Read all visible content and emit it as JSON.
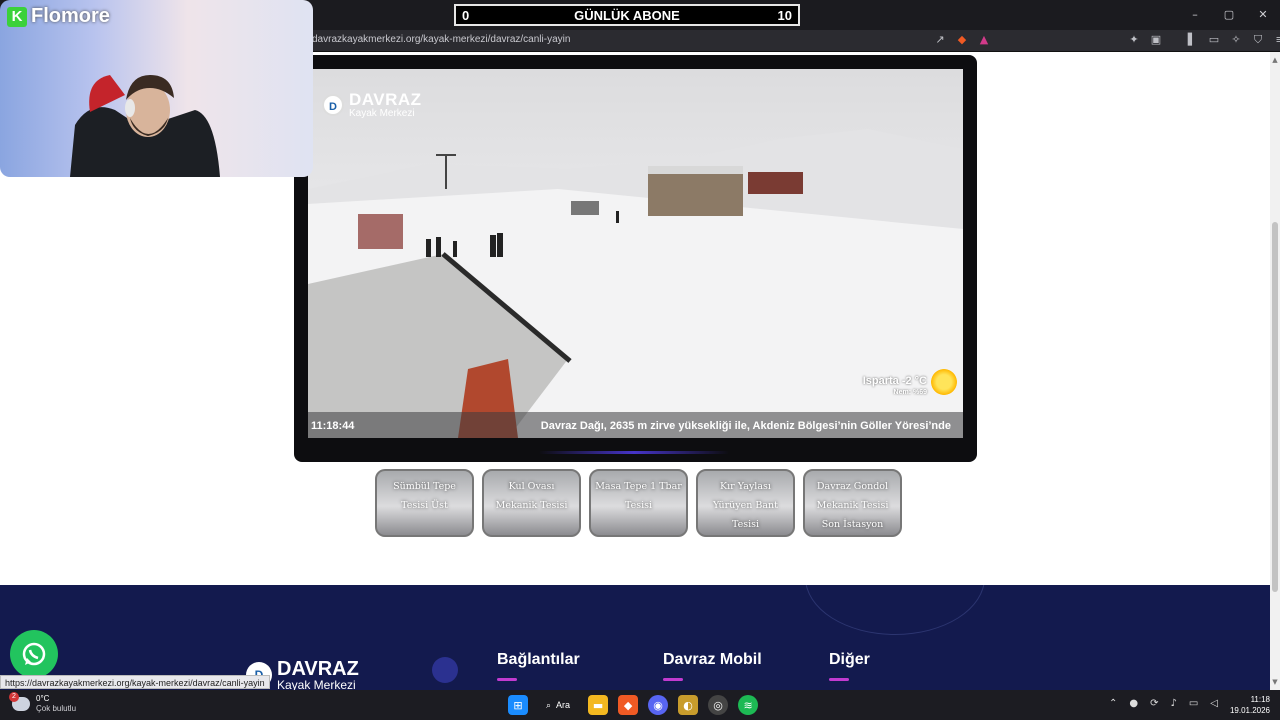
{
  "subscriber_counter": {
    "current": "0",
    "label": "GÜNLÜK ABONE",
    "goal": "10"
  },
  "window_controls": {
    "minimize": "–",
    "maximize": "▢",
    "close": "✕"
  },
  "browser": {
    "url": "davrazkayakmerkezi.org/kayak-merkezi/davraz/canli-yayin"
  },
  "webcam": {
    "brand": "Flomore",
    "brand_initial": "K"
  },
  "stream": {
    "logo_title": "DAVRAZ",
    "logo_subtitle": "Kayak Merkezi",
    "clock": "11:18:44",
    "ticker": "Davraz Dağı, 2635 m zirve yüksekliği ile, Akdeniz Bölgesi’nin Göller Yöresi’nde",
    "weather_location_temp": "Isparta -2 °C",
    "weather_humidity": "Nem: %69",
    "weather_icon": "sun-icon"
  },
  "cameras": [
    {
      "label": "Sümbül Tepe Tesisi Üst"
    },
    {
      "label": "Kul Ovası Mekanik Tesisi"
    },
    {
      "label": "Masa Tepe 1 Tbar Tesisi"
    },
    {
      "label": "Kır Yaylası Yürüyen Bant Tesisi"
    },
    {
      "label": "Davraz Gondol Mekanik Tesisi Son İstasyon"
    }
  ],
  "footer": {
    "logo_title": "DAVRAZ",
    "logo_subtitle": "Kayak Merkezi",
    "headings": [
      "Bağlantılar",
      "Davraz Mobil",
      "Diğer"
    ],
    "accent_color": "#c23bd0"
  },
  "status_url": "https://davrazkayakmerkezi.org/kayak-merkezi/davraz/canli-yayin",
  "taskbar": {
    "weather_temp": "0°C",
    "weather_desc": "Çok bulutlu",
    "weather_badge": "2",
    "search_label": "Ara",
    "time": "11:18",
    "date": "19.01.2026"
  }
}
